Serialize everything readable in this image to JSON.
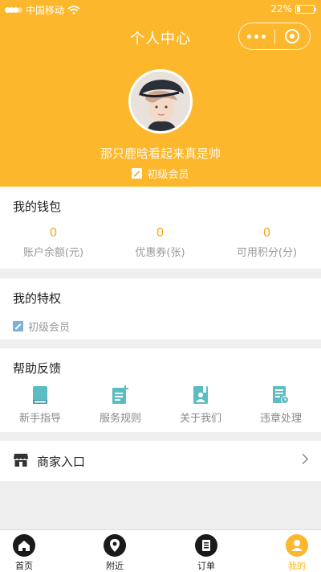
{
  "statusbar": {
    "carrier": "中国移动",
    "battery": "22%",
    "battery_level": 0.22
  },
  "header": {
    "title": "个人中心",
    "username": "那只鹿晗看起来真是帅",
    "member_level": "初级会员"
  },
  "wallet": {
    "title": "我的钱包",
    "items": [
      {
        "value": "0",
        "label": "账户余额(元)"
      },
      {
        "value": "0",
        "label": "优惠券(张)"
      },
      {
        "value": "0",
        "label": "可用积分(分)"
      }
    ]
  },
  "privileges": {
    "title": "我的特权",
    "level": "初级会员"
  },
  "help": {
    "title": "帮助反馈",
    "items": [
      {
        "label": "新手指导",
        "icon": "book-icon"
      },
      {
        "label": "服务规则",
        "icon": "document-add-icon"
      },
      {
        "label": "关于我们",
        "icon": "contact-book-icon"
      },
      {
        "label": "违章处理",
        "icon": "document-clock-icon"
      }
    ]
  },
  "merchant": {
    "label": "商家入口"
  },
  "tabbar": {
    "items": [
      {
        "label": "首页",
        "icon": "home-icon"
      },
      {
        "label": "附近",
        "icon": "location-pin-icon"
      },
      {
        "label": "订单",
        "icon": "order-list-icon"
      },
      {
        "label": "我的",
        "icon": "user-icon",
        "active": true
      }
    ]
  },
  "colors": {
    "accent": "#fcb72c",
    "icon_teal": "#5bbcc2",
    "value_orange": "#f5a623"
  }
}
